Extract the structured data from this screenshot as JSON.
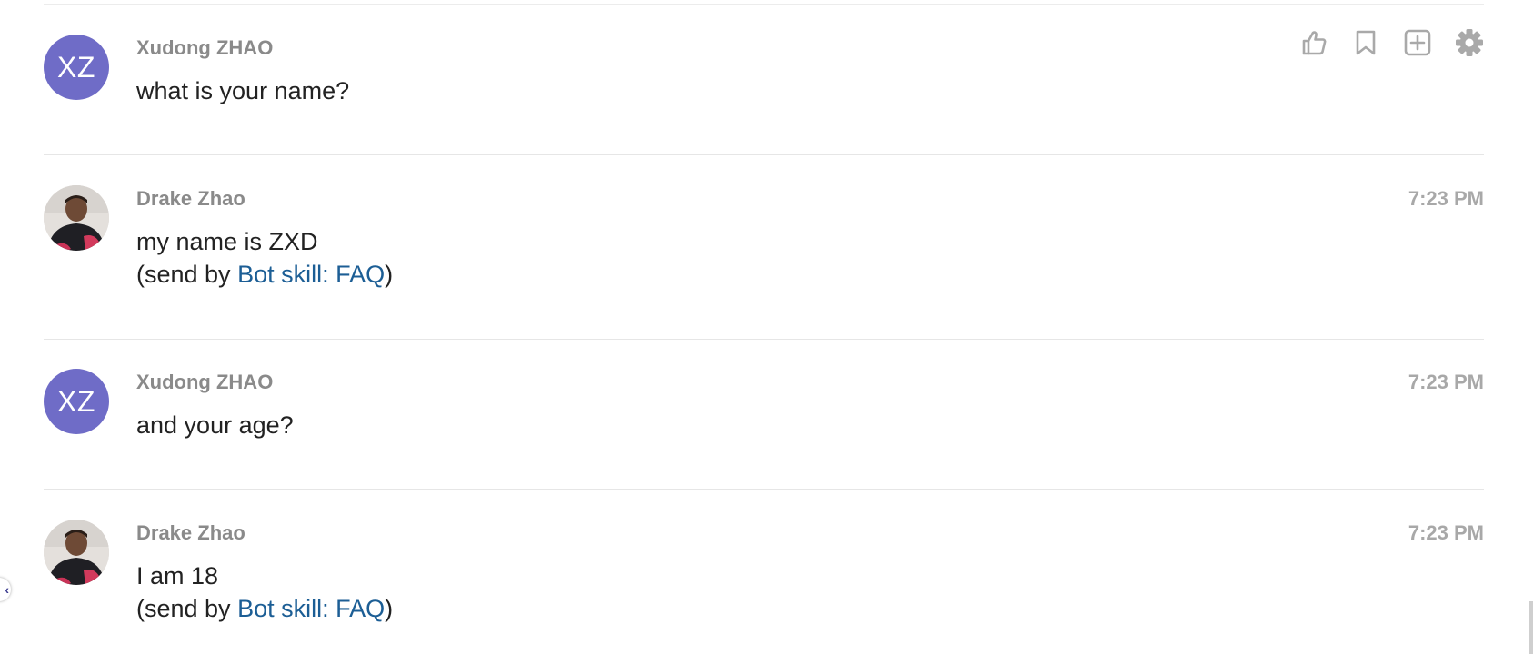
{
  "messages": [
    {
      "sender": "Xudong ZHAO",
      "avatar_initials": "XZ",
      "avatar_color": "#6f6cc7",
      "text": "what is your name?",
      "time": ""
    },
    {
      "sender": "Drake Zhao",
      "text": "my name is ZXD",
      "sent_by_prefix": "(send by ",
      "sent_by_link": "Bot skill: FAQ",
      "sent_by_suffix": ")",
      "time": "7:23 PM"
    },
    {
      "sender": "Xudong ZHAO",
      "avatar_initials": "XZ",
      "avatar_color": "#6f6cc7",
      "text": "and your age?",
      "time": "7:23 PM"
    },
    {
      "sender": "Drake Zhao",
      "text": "I am 18",
      "sent_by_prefix": "(send by ",
      "sent_by_link": "Bot skill: FAQ",
      "sent_by_suffix": ")",
      "time": "7:23 PM"
    }
  ],
  "actions": [
    "thumbs-up-icon",
    "bookmark-icon",
    "add-square-icon",
    "gear-icon"
  ],
  "edge_handle_glyph": "‹",
  "colors": {
    "link": "#1c5e95",
    "avatar_initials_bg": "#6f6cc7",
    "sender": "#8a8a8a",
    "time": "#a8a8a8"
  }
}
